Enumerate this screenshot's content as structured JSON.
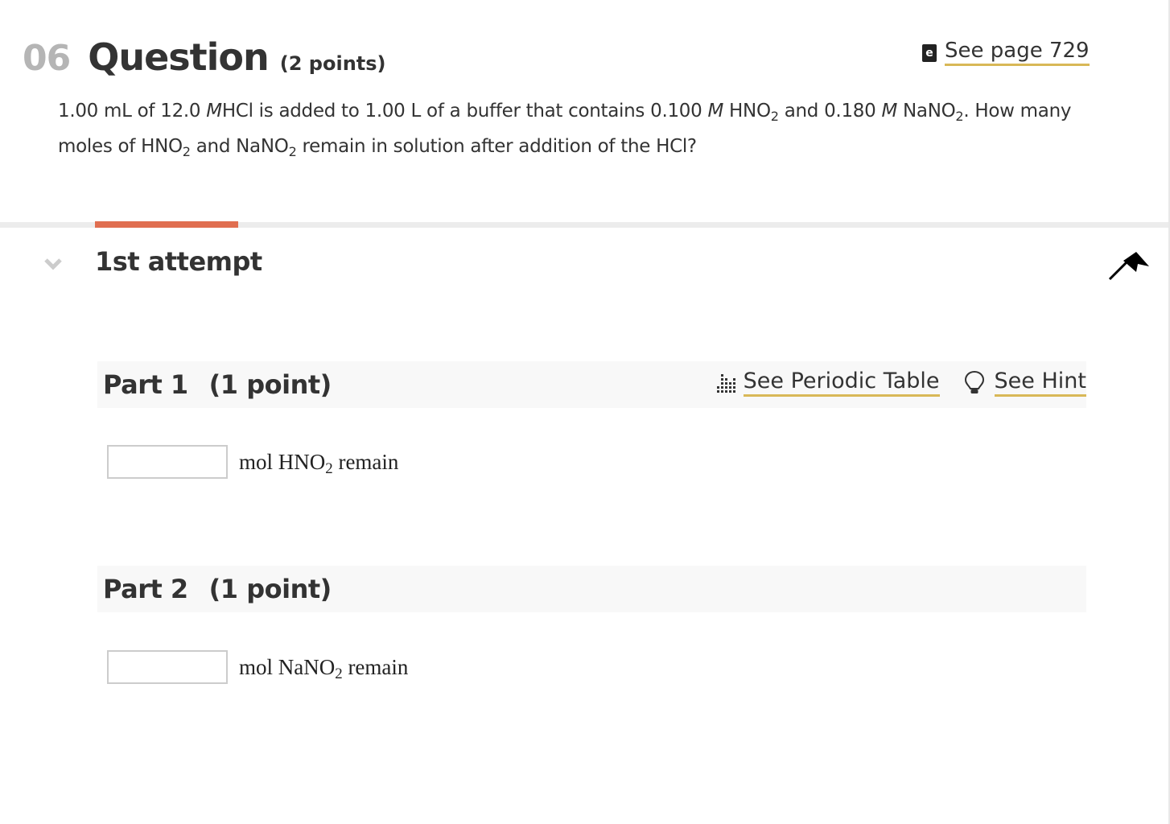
{
  "question": {
    "number": "06",
    "word": "Question",
    "points": "(2 points)",
    "textbook_link": {
      "icon": "ebook-icon",
      "icon_glyph": "e",
      "label": "See page 729"
    },
    "text": {
      "line1": {
        "p1": "1.00 mL of 12.0 ",
        "m1": "M",
        "p2": "HCl is added to 1.00 L of a buffer that contains  0.100 ",
        "m2": "M",
        "p3": " HNO",
        "s1": "2",
        "p4": " and 0.180 ",
        "m3": "M",
        "p5": " NaNO",
        "s2": "2",
        "p6": ". How many"
      },
      "line2": {
        "p1": "moles of HNO",
        "s1": "2",
        "p2": " and NaNO",
        "s2": "2",
        "p3": " remain in solution after addition of the HCl?"
      }
    }
  },
  "attempt": {
    "title": "1st attempt",
    "collapse_icon": "chevron-down-icon",
    "flag_icon": "flag-icon"
  },
  "colors": {
    "accent_tab": "#e06e50",
    "link_underline": "#d8b857",
    "question_number": "#b5b5b5",
    "part_header_bg": "#f8f8f8"
  },
  "parts": [
    {
      "title": "Part 1",
      "points": "(1 point)",
      "tools": [
        {
          "icon": "periodic-table-icon",
          "label": "See Periodic Table"
        },
        {
          "icon": "lightbulb-icon",
          "label": "See Hint"
        }
      ],
      "answer": {
        "value": "",
        "placeholder": "",
        "label_pre": "mol HNO",
        "label_sub": "2",
        "label_post": " remain"
      }
    },
    {
      "title": "Part 2",
      "points": "(1 point)",
      "tools": [],
      "answer": {
        "value": "",
        "placeholder": "",
        "label_pre": "mol NaNO",
        "label_sub": "2",
        "label_post": " remain"
      }
    }
  ]
}
